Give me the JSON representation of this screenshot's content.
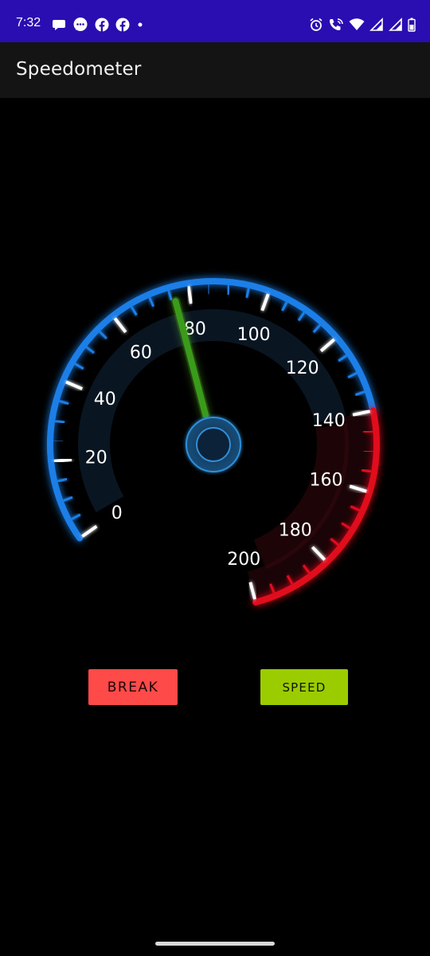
{
  "status_bar": {
    "time": "7:32",
    "left_icons": [
      "chat-bubble-icon",
      "messages-icon",
      "facebook-icon",
      "facebook-icon",
      "dot-icon"
    ],
    "right_icons": [
      "alarm-icon",
      "wifi-calling-icon",
      "wifi-icon",
      "signal-icon",
      "signal-icon",
      "battery-icon"
    ],
    "background": "#2a0eb1"
  },
  "app_bar": {
    "title": "Speedometer"
  },
  "speedometer": {
    "current_speed": 76,
    "min": 0,
    "max": 200,
    "tick_labels": [
      "0",
      "20",
      "40",
      "60",
      "80",
      "100",
      "120",
      "140",
      "160",
      "180",
      "200"
    ],
    "redline_from": 140,
    "colors": {
      "arc": "#1e7fe8",
      "redline": "#e0101e",
      "needle": "#3a9a1a",
      "hub": "#2f8fd8"
    }
  },
  "buttons": {
    "break_label": "BREAK",
    "speed_label": "SPEED",
    "break_color": "#ff4a4a",
    "speed_color": "#9bcc00"
  }
}
